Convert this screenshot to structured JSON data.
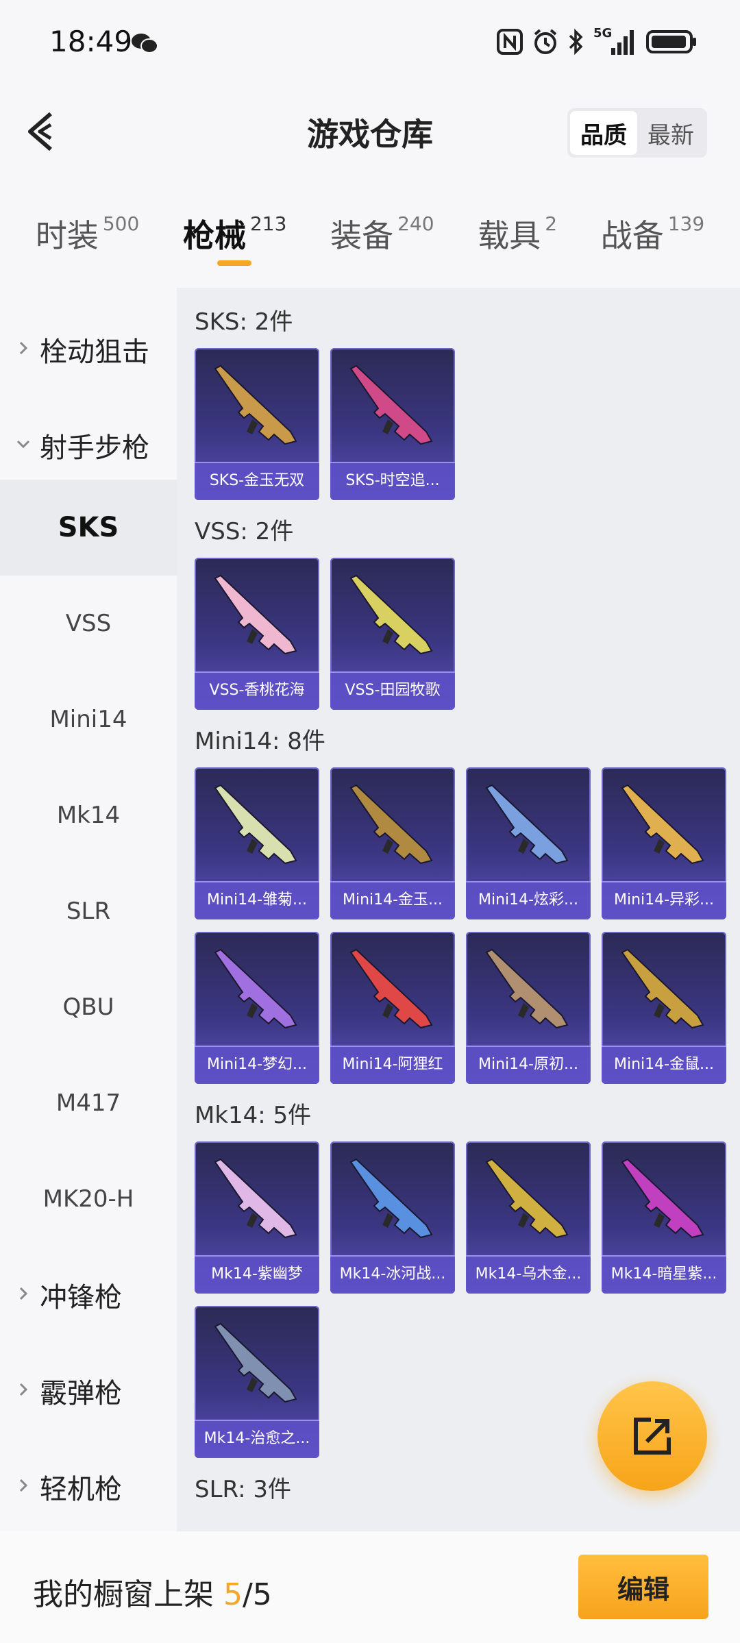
{
  "status_bar": {
    "time": "18:49",
    "network": "5G"
  },
  "header": {
    "title": "游戏仓库",
    "sort_options": [
      "品质",
      "最新"
    ],
    "active_sort": 0
  },
  "main_tabs": [
    {
      "label": "时装",
      "count": "500"
    },
    {
      "label": "枪械",
      "count": "213"
    },
    {
      "label": "装备",
      "count": "240"
    },
    {
      "label": "载具",
      "count": "2"
    },
    {
      "label": "战备",
      "count": "139"
    }
  ],
  "sidebar": {
    "groups": [
      "栓动狙击",
      "射手步枪",
      "冲锋枪",
      "霰弹枪",
      "轻机枪"
    ],
    "sub_items": [
      "SKS",
      "VSS",
      "Mini14",
      "Mk14",
      "SLR",
      "QBU",
      "M417",
      "MK20-H"
    ],
    "active_item": "SKS"
  },
  "sections": [
    {
      "title": "SKS: 2件",
      "items": [
        "SKS-金玉无双",
        "SKS-时空追..."
      ]
    },
    {
      "title": "VSS: 2件",
      "items": [
        "VSS-香桃花海",
        "VSS-田园牧歌"
      ]
    },
    {
      "title": "Mini14: 8件",
      "items": [
        "Mini14-雏菊...",
        "Mini14-金玉...",
        "Mini14-炫彩...",
        "Mini14-异彩...",
        "Mini14-梦幻...",
        "Mini14-阿狸红",
        "Mini14-原初...",
        "Mini14-金鼠..."
      ]
    },
    {
      "title": "Mk14: 5件",
      "items": [
        "Mk14-紫幽梦",
        "Mk14-冰河战...",
        "Mk14-乌木金...",
        "Mk14-暗星紫...",
        "Mk14-治愈之..."
      ]
    },
    {
      "title": "SLR: 3件",
      "items": []
    }
  ],
  "gun_colors": {
    "SKS-金玉无双": "#c89a4a",
    "SKS-时空追...": "#d04a8a",
    "VSS-香桃花海": "#f0b8d0",
    "VSS-田园牧歌": "#d8d060",
    "Mini14-雏菊...": "#d8e0b0",
    "Mini14-金玉...": "#b08a40",
    "Mini14-炫彩...": "#7aa0e0",
    "Mini14-异彩...": "#e0b050",
    "Mini14-梦幻...": "#a070e0",
    "Mini14-阿狸红": "#e04848",
    "Mini14-原初...": "#b09070",
    "Mini14-金鼠...": "#c8a040",
    "Mk14-紫幽梦": "#e0b8e8",
    "Mk14-冰河战...": "#5a90e0",
    "Mk14-乌木金...": "#d0b040",
    "Mk14-暗星紫...": "#c040c0",
    "Mk14-治愈之...": "#8090b0"
  },
  "footer": {
    "label": "我的橱窗上架 ",
    "count": "5",
    "separator": "/",
    "total": "5",
    "edit_label": "编辑"
  },
  "colors": {
    "accent": "#f5a623",
    "card_bg": "#3b3681"
  }
}
